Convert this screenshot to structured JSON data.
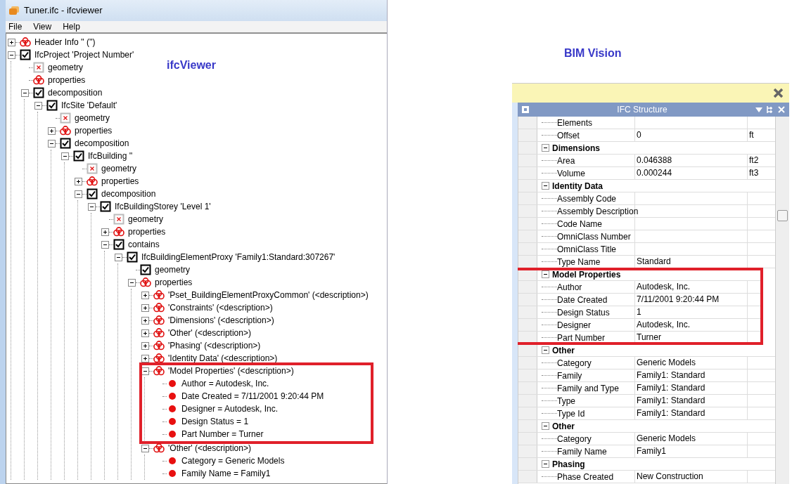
{
  "left_window": {
    "title": "Tuner.ifc - ifcviewer",
    "menu": [
      "File",
      "View",
      "Help"
    ],
    "caption": "ifcViewer",
    "tree": [
      {
        "label": "Header Info '' ('')",
        "kind": "properties",
        "expanded": false
      },
      {
        "label": "IfcProject 'Project Number'",
        "kind": "checkbox",
        "expanded": true,
        "children": [
          {
            "label": "geometry",
            "kind": "geometry"
          },
          {
            "label": "properties",
            "kind": "properties"
          },
          {
            "label": "decomposition",
            "kind": "checkbox",
            "expanded": true,
            "children": [
              {
                "label": "IfcSite 'Default'",
                "kind": "checkbox",
                "expanded": true,
                "children": [
                  {
                    "label": "geometry",
                    "kind": "geometry"
                  },
                  {
                    "label": "properties",
                    "kind": "properties",
                    "expanded": false
                  },
                  {
                    "label": "decomposition",
                    "kind": "checkbox",
                    "expanded": true,
                    "children": [
                      {
                        "label": "IfcBuilding ''",
                        "kind": "checkbox",
                        "expanded": true,
                        "children": [
                          {
                            "label": "geometry",
                            "kind": "geometry"
                          },
                          {
                            "label": "properties",
                            "kind": "properties",
                            "expanded": false
                          },
                          {
                            "label": "decomposition",
                            "kind": "checkbox",
                            "expanded": true,
                            "children": [
                              {
                                "label": "IfcBuildingStorey 'Level 1'",
                                "kind": "checkbox",
                                "expanded": true,
                                "children": [
                                  {
                                    "label": "geometry",
                                    "kind": "geometry"
                                  },
                                  {
                                    "label": "properties",
                                    "kind": "properties",
                                    "expanded": false
                                  },
                                  {
                                    "label": "contains",
                                    "kind": "checkbox",
                                    "expanded": true,
                                    "children": [
                                      {
                                        "label": "IfcBuildingElementProxy 'Family1:Standard:307267'",
                                        "kind": "checkbox",
                                        "expanded": true,
                                        "children": [
                                          {
                                            "label": "geometry",
                                            "kind": "checkbox"
                                          },
                                          {
                                            "label": "properties",
                                            "kind": "properties",
                                            "expanded": true,
                                            "children": [
                                              {
                                                "label": "'Pset_BuildingElementProxyCommon' (<description>)",
                                                "kind": "properties",
                                                "expanded": false
                                              },
                                              {
                                                "label": "'Constraints' (<description>)",
                                                "kind": "properties",
                                                "expanded": false
                                              },
                                              {
                                                "label": "'Dimensions' (<description>)",
                                                "kind": "properties",
                                                "expanded": false
                                              },
                                              {
                                                "label": "'Other' (<description>)",
                                                "kind": "properties",
                                                "expanded": false
                                              },
                                              {
                                                "label": "'Phasing' (<description>)",
                                                "kind": "properties",
                                                "expanded": false
                                              },
                                              {
                                                "label": "'Identity Data' (<description>)",
                                                "kind": "properties",
                                                "expanded": false
                                              },
                                              {
                                                "label": "'Model Properties' (<description>)",
                                                "kind": "properties",
                                                "expanded": true,
                                                "highlighted": true,
                                                "children": [
                                                  {
                                                    "label": "Author = Autodesk, Inc.",
                                                    "kind": "dot"
                                                  },
                                                  {
                                                    "label": "Date Created = 7/11/2001 9:20:44 PM",
                                                    "kind": "dot"
                                                  },
                                                  {
                                                    "label": "Designer = Autodesk, Inc.",
                                                    "kind": "dot"
                                                  },
                                                  {
                                                    "label": "Design Status = 1",
                                                    "kind": "dot"
                                                  },
                                                  {
                                                    "label": "Part Number = Turner",
                                                    "kind": "dot"
                                                  }
                                                ]
                                              },
                                              {
                                                "label": "'Other' (<description>)",
                                                "kind": "properties",
                                                "expanded": true,
                                                "children": [
                                                  {
                                                    "label": "Category = Generic Models",
                                                    "kind": "dot"
                                                  },
                                                  {
                                                    "label": "Family Name = Family1",
                                                    "kind": "dot"
                                                  }
                                                ]
                                              }
                                            ]
                                          }
                                        ]
                                      }
                                    ]
                                  }
                                ]
                              }
                            ]
                          }
                        ]
                      }
                    ]
                  }
                ]
              }
            ]
          }
        ]
      }
    ]
  },
  "right_window": {
    "caption": "BIM Vision",
    "panel_title": "IFC Structure",
    "groups": [
      {
        "rows": [
          {
            "name": "Elements"
          },
          {
            "name": "Offset",
            "value": "0",
            "unit": "ft"
          }
        ]
      },
      {
        "title": "Dimensions",
        "expanded": true,
        "rows": [
          {
            "name": "Area",
            "value": "0.046388",
            "unit": "ft2"
          },
          {
            "name": "Volume",
            "value": "0.000244",
            "unit": "ft3"
          }
        ]
      },
      {
        "title": "Identity Data",
        "expanded": true,
        "rows": [
          {
            "name": "Assembly Code"
          },
          {
            "name": "Assembly Description"
          },
          {
            "name": "Code Name"
          },
          {
            "name": "OmniClass Number"
          },
          {
            "name": "OmniClass Title"
          },
          {
            "name": "Type Name",
            "value": "Standard"
          }
        ]
      },
      {
        "title": "Model Properties",
        "expanded": true,
        "highlighted": true,
        "rows": [
          {
            "name": "Author",
            "value": "Autodesk, Inc."
          },
          {
            "name": "Date Created",
            "value": "7/11/2001 9:20:44 PM"
          },
          {
            "name": "Design Status",
            "value": "1"
          },
          {
            "name": "Designer",
            "value": "Autodesk, Inc."
          },
          {
            "name": "Part Number",
            "value": "Turner"
          }
        ]
      },
      {
        "title": "Other",
        "expanded": true,
        "rows": [
          {
            "name": "Category",
            "value": "Generic Models"
          },
          {
            "name": "Family",
            "value": "Family1: Standard"
          },
          {
            "name": "Family and Type",
            "value": "Family1: Standard"
          },
          {
            "name": "Type",
            "value": "Family1: Standard"
          },
          {
            "name": "Type Id",
            "value": "Family1: Standard"
          }
        ]
      },
      {
        "title": "Other",
        "expanded": true,
        "rows": [
          {
            "name": "Category",
            "value": "Generic Models"
          },
          {
            "name": "Family Name",
            "value": "Family1"
          }
        ]
      },
      {
        "title": "Phasing",
        "expanded": true,
        "rows": [
          {
            "name": "Phase Created",
            "value": "New Construction"
          }
        ]
      }
    ]
  }
}
